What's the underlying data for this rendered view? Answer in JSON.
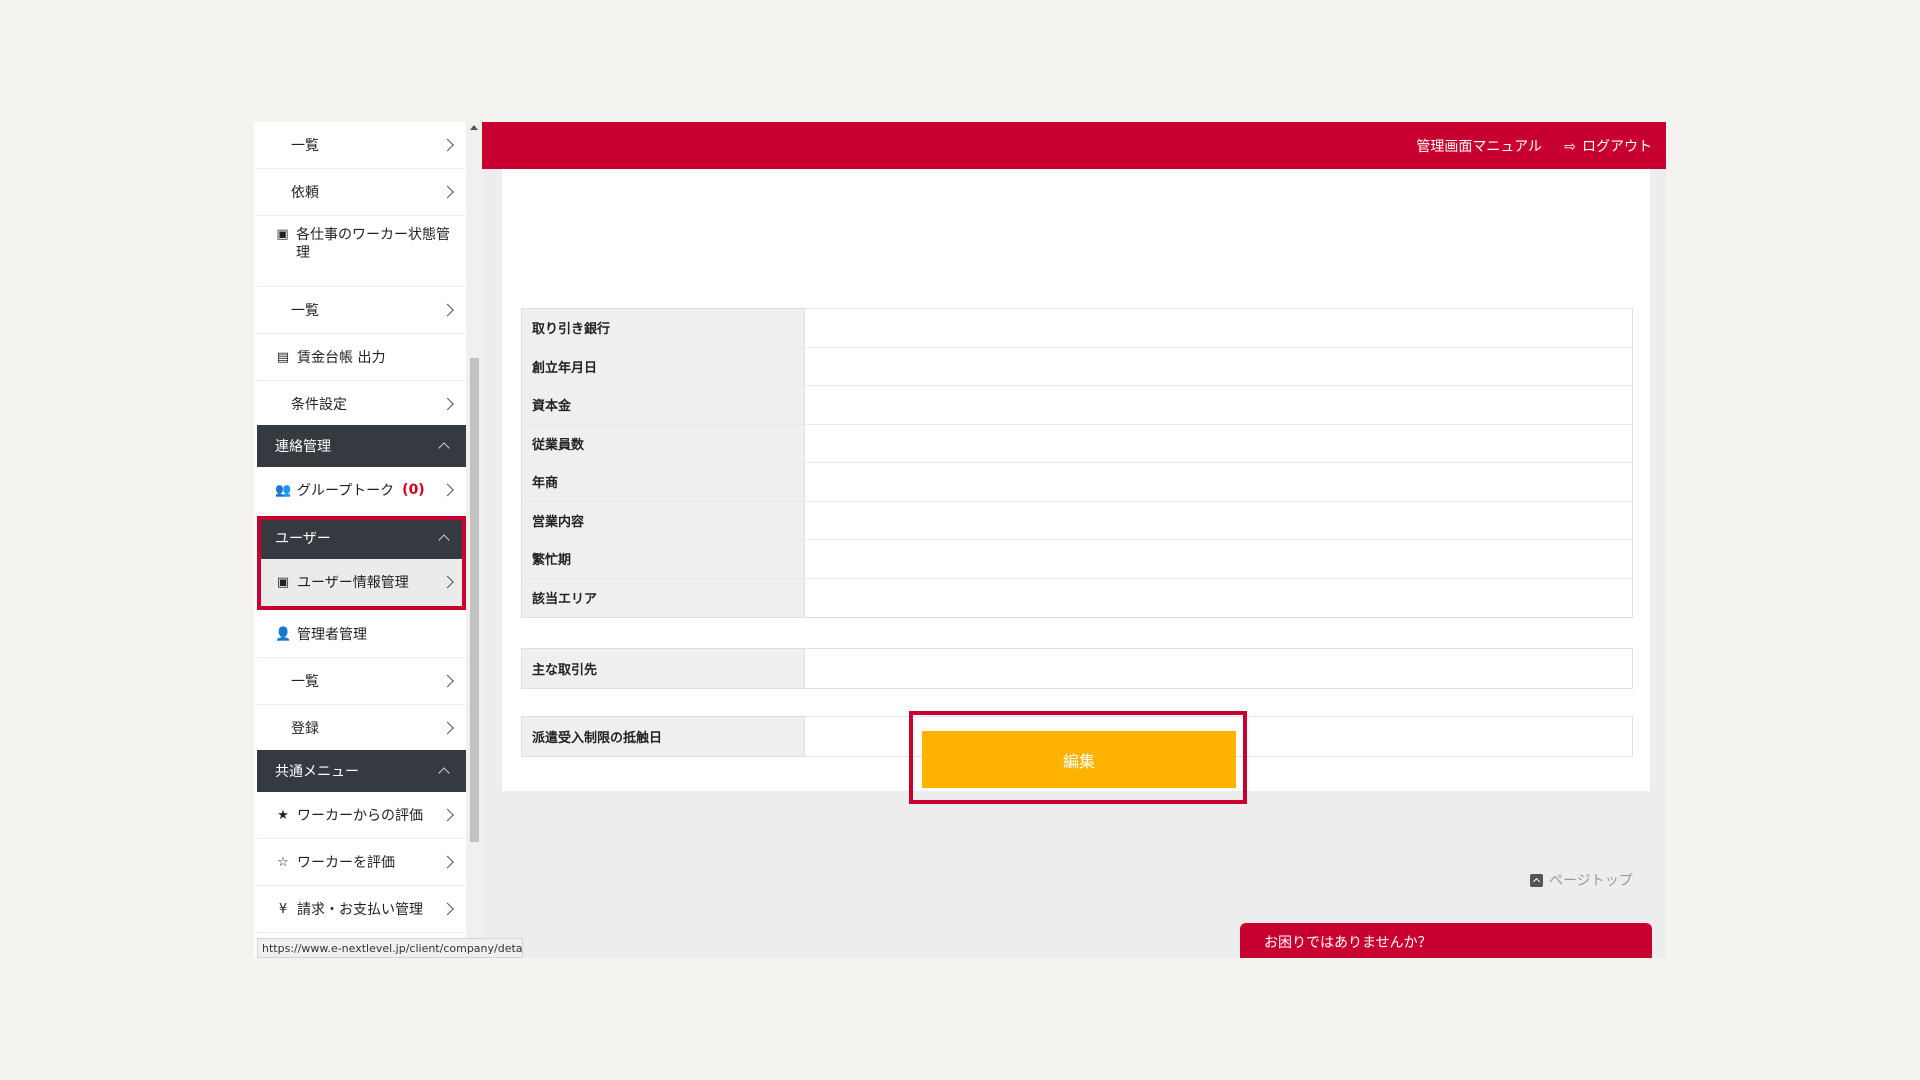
{
  "sidebar": {
    "items": [
      {
        "label": "一覧"
      },
      {
        "label": "依頼"
      },
      {
        "label": "各仕事のワーカー状態管理",
        "icon": "id-card-icon"
      },
      {
        "label": "一覧"
      },
      {
        "label": "賃金台帳 出力",
        "icon": "file-icon"
      },
      {
        "label": "条件設定"
      }
    ],
    "contact_header": "連絡管理",
    "group_talk": {
      "label": "グループトーク",
      "count": "(0)"
    },
    "user_header": "ユーザー",
    "user_info": "ユーザー情報管理",
    "admin": "管理者管理",
    "admin_list": "一覧",
    "admin_register": "登録",
    "common_header": "共通メニュー",
    "rating_from_worker": "ワーカーからの評価",
    "rate_worker": "ワーカーを評価",
    "billing": "請求・お支払い管理"
  },
  "status_url": "https://www.e-nextlevel.jp/client/company/detail",
  "topbar": {
    "manual": "管理画面マニュアル",
    "logout": "ログアウト"
  },
  "table1": [
    {
      "label": "取り引き銀行",
      "value": ""
    },
    {
      "label": "創立年月日",
      "value": ""
    },
    {
      "label": "資本金",
      "value": ""
    },
    {
      "label": "従業員数",
      "value": ""
    },
    {
      "label": "年商",
      "value": ""
    },
    {
      "label": "営業内容",
      "value": ""
    },
    {
      "label": "繁忙期",
      "value": ""
    },
    {
      "label": "該当エリア",
      "value": ""
    }
  ],
  "table2": [
    {
      "label": "主な取引先",
      "value": ""
    }
  ],
  "table3": [
    {
      "label": "派遣受入制限の抵触日",
      "value": ""
    }
  ],
  "edit_button": "編集",
  "page_top": "ページトップ",
  "help": "お困りではありませんか？",
  "colors": {
    "brand": "#c8002f",
    "button": "#ffb300",
    "sidebar_header": "#353a40"
  }
}
